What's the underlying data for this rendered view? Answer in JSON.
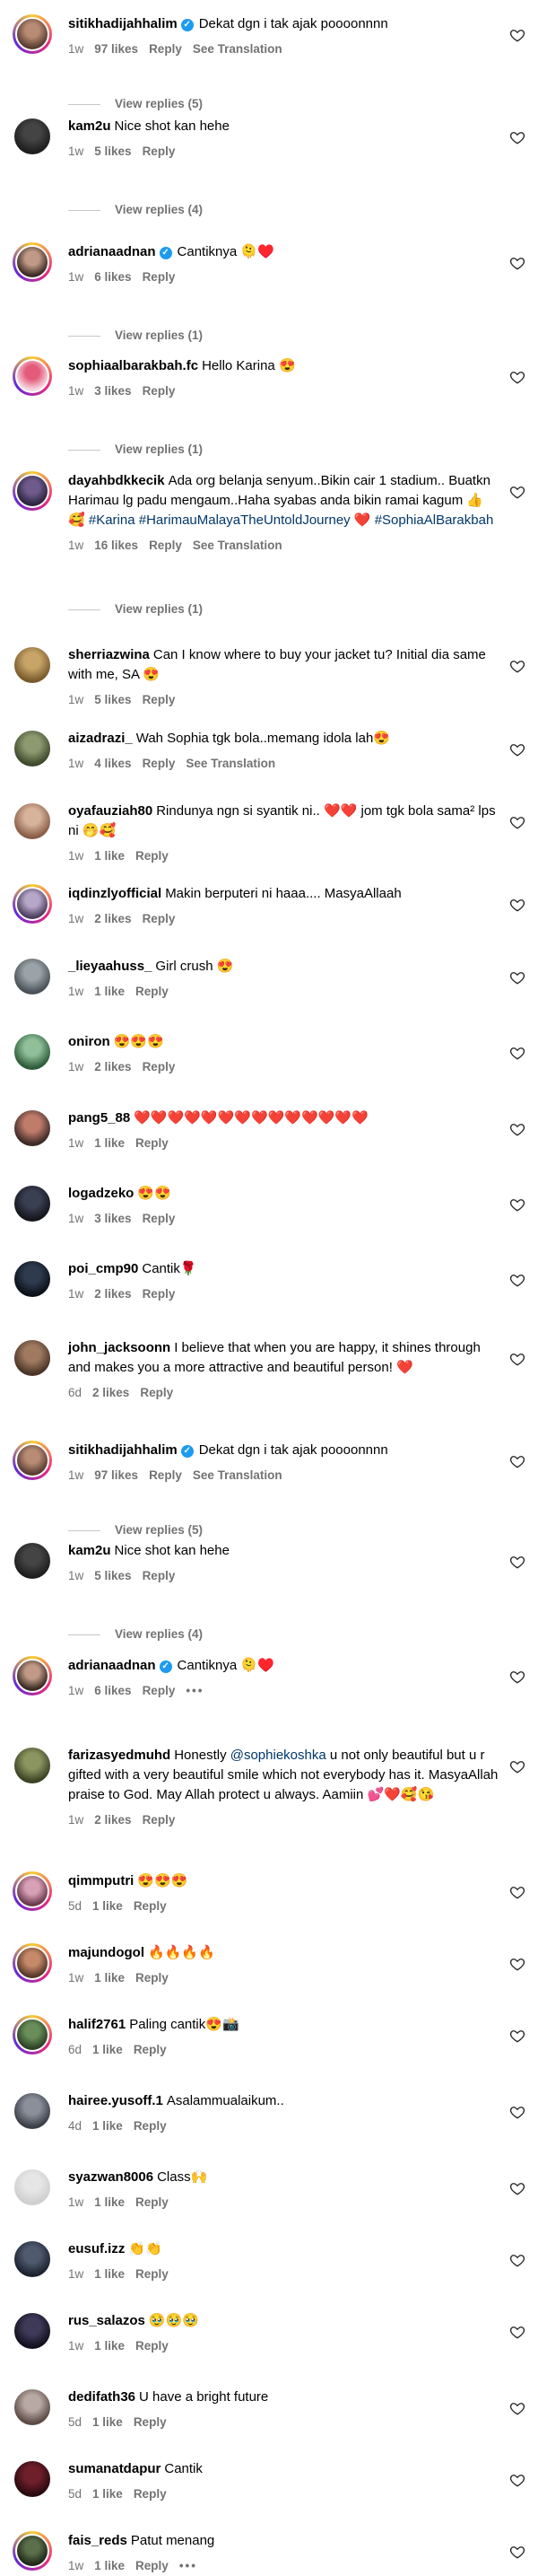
{
  "ui": {
    "reply_label": "Reply",
    "see_translation_label": "See Translation",
    "more_label": "•••",
    "verified_mark": "✓"
  },
  "comments": [
    {
      "username": "sitikhadijahhalim",
      "verified": true,
      "text": "Dekat dgn i tak ajak poooonnnn",
      "time": "1w",
      "likes": "97 likes",
      "see_translation": true,
      "view_replies": "View replies (5)",
      "avatar_colors": [
        "#b78b74",
        "#5a3d32"
      ],
      "ring": true
    },
    {
      "username": "kam2u",
      "verified": false,
      "text": "Nice shot kan hehe",
      "time": "1w",
      "likes": "5 likes",
      "see_translation": false,
      "view_replies": "View replies (4)",
      "avatar_colors": [
        "#444444",
        "#1e1e1e"
      ],
      "ring": false
    },
    {
      "username": "adrianaadnan",
      "verified": true,
      "text": "Cantiknya 🫠♥️",
      "time": "1w",
      "likes": "6 likes",
      "see_translation": false,
      "view_replies": "View replies (1)",
      "avatar_colors": [
        "#c09a86",
        "#3b2a24"
      ],
      "ring": true
    },
    {
      "username": "sophiaalbarakbah.fc",
      "verified": false,
      "text": "Hello Karina 😍",
      "time": "1w",
      "likes": "3 likes",
      "see_translation": false,
      "view_replies": "View replies (1)",
      "avatar_colors": [
        "#e35a7a",
        "#f6d7e0"
      ],
      "ring": true
    },
    {
      "username": "dayahbdkkecik",
      "verified": false,
      "text": "Ada org belanja senyum..Bikin cair 1 stadium.. Buatkn Harimau lg padu mengaum..Haha syabas anda bikin ramai kagum 👍🥰",
      "tags": "#Karina #HarimauMalayaTheUntoldJourney ❤️ #SophiaAlBarakbah",
      "time": "1w",
      "likes": "16 likes",
      "see_translation": true,
      "view_replies": "View replies (1)",
      "avatar_colors": [
        "#6f5a8c",
        "#2c2440"
      ],
      "ring": true
    },
    {
      "username": "sherriazwina",
      "verified": false,
      "text": "Can I know where to buy your jacket tu? Initial dia same with me, SA 😍",
      "time": "1w",
      "likes": "5 likes",
      "see_translation": false,
      "avatar_colors": [
        "#c7a468",
        "#7a5b2c"
      ],
      "ring": false
    },
    {
      "username": "aizadrazi_",
      "verified": false,
      "text": "Wah Sophia tgk bola..memang idola lah😍",
      "time": "1w",
      "likes": "4 likes",
      "see_translation": true,
      "avatar_colors": [
        "#8c9a70",
        "#3e4a2c"
      ],
      "ring": false
    },
    {
      "username": "oyafauziah80",
      "verified": false,
      "text": "Rindunya ngn si syantik ni.. ❤️❤️ jom tgk bola sama² lps ni 🤭🥰",
      "time": "1w",
      "likes": "1 like",
      "see_translation": false,
      "avatar_colors": [
        "#d6b39a",
        "#8a5d48"
      ],
      "ring": false
    },
    {
      "username": "iqdinzlyofficial",
      "verified": false,
      "text": "Makin berputeri ni haaa.... MasyaAllaah",
      "time": "1w",
      "likes": "2 likes",
      "see_translation": false,
      "avatar_colors": [
        "#b6a6c8",
        "#4d3f5e"
      ],
      "ring": true
    },
    {
      "username": "_lieyaahuss_",
      "verified": false,
      "text": "Girl crush 😍",
      "time": "1w",
      "likes": "1 like",
      "see_translation": false,
      "avatar_colors": [
        "#9aa3a8",
        "#4a5156"
      ],
      "ring": false
    },
    {
      "username": "oniron",
      "verified": false,
      "text": "😍😍😍",
      "time": "1w",
      "likes": "2 likes",
      "see_translation": false,
      "avatar_colors": [
        "#8fc09a",
        "#2f5c3a"
      ],
      "ring": false
    },
    {
      "username": "pang5_88",
      "verified": false,
      "text": "❤️❤️❤️❤️❤️❤️❤️❤️❤️❤️❤️❤️❤️❤️",
      "time": "1w",
      "likes": "1 like",
      "see_translation": false,
      "avatar_colors": [
        "#c07c6a",
        "#3d2a26"
      ],
      "ring": false
    },
    {
      "username": "logadzeko",
      "verified": false,
      "text": "😍😍",
      "time": "1w",
      "likes": "3 likes",
      "see_translation": false,
      "avatar_colors": [
        "#3b3f52",
        "#15161d"
      ],
      "ring": false
    },
    {
      "username": "poi_cmp90",
      "verified": false,
      "text": "Cantik🌹",
      "time": "1w",
      "likes": "2 likes",
      "see_translation": false,
      "avatar_colors": [
        "#2e3b4f",
        "#0c1119"
      ],
      "ring": false
    },
    {
      "username": "john_jacksoonn",
      "verified": false,
      "text": "I believe that when you are happy, it shines through and makes you a more attractive and beautiful person! ❤️",
      "time": "6d",
      "likes": "2 likes",
      "see_translation": false,
      "avatar_colors": [
        "#a07a60",
        "#4a3528"
      ],
      "ring": false
    },
    {
      "username": "sitikhadijahhalim",
      "verified": true,
      "text": "Dekat dgn i tak ajak poooonnnn",
      "time": "1w",
      "likes": "97 likes",
      "see_translation": true,
      "view_replies": "View replies (5)",
      "avatar_colors": [
        "#b78b74",
        "#5a3d32"
      ],
      "ring": true
    },
    {
      "username": "kam2u",
      "verified": false,
      "text": "Nice shot kan hehe",
      "time": "1w",
      "likes": "5 likes",
      "see_translation": false,
      "view_replies": "View replies (4)",
      "avatar_colors": [
        "#444444",
        "#1e1e1e"
      ],
      "ring": false
    },
    {
      "username": "adrianaadnan",
      "verified": true,
      "text": "Cantiknya 🫠♥️",
      "time": "1w",
      "likes": "6 likes",
      "see_translation": false,
      "more": true,
      "avatar_colors": [
        "#c09a86",
        "#3b2a24"
      ],
      "ring": true
    },
    {
      "username": "farizasyedmuhd",
      "verified": false,
      "text": "Honestly",
      "mention": "@sophiekoshka",
      "text2": "u not only beautiful but u r gifted with a very beautiful smile which not everybody has it. MasyaAllah praise to God. May Allah protect u always. Aamiin 💕❤️🥰😘",
      "time": "1w",
      "likes": "2 likes",
      "see_translation": false,
      "avatar_colors": [
        "#8a9560",
        "#3c4324"
      ],
      "ring": false
    },
    {
      "username": "qimmputri",
      "verified": false,
      "text": "😍😍😍",
      "time": "5d",
      "likes": "1 like",
      "see_translation": false,
      "avatar_colors": [
        "#d7a0b5",
        "#6b3a4c"
      ],
      "ring": true
    },
    {
      "username": "majundogol",
      "verified": false,
      "text": "🔥🔥🔥🔥",
      "time": "1w",
      "likes": "1 like",
      "see_translation": false,
      "avatar_colors": [
        "#c68a6a",
        "#56382a"
      ],
      "ring": true
    },
    {
      "username": "halif2761",
      "verified": false,
      "text": "Paling cantik😍📸",
      "time": "6d",
      "likes": "1 like",
      "see_translation": false,
      "avatar_colors": [
        "#6a8e5a",
        "#2d4226"
      ],
      "ring": true
    },
    {
      "username": "hairee.yusoff.1",
      "verified": false,
      "text": "Asalammualaikum..",
      "time": "4d",
      "likes": "1 like",
      "see_translation": false,
      "avatar_colors": [
        "#8a8f9a",
        "#3b3f47"
      ],
      "ring": false
    },
    {
      "username": "syazwan8006",
      "verified": false,
      "text": "Class🙌",
      "time": "1w",
      "likes": "1 like",
      "see_translation": false,
      "avatar_colors": [
        "#e6e6e6",
        "#cfcfcf"
      ],
      "ring": false
    },
    {
      "username": "eusuf.izz",
      "verified": false,
      "text": "👏👏",
      "time": "1w",
      "likes": "1 like",
      "see_translation": false,
      "avatar_colors": [
        "#4f5a6e",
        "#1c2230"
      ],
      "ring": false
    },
    {
      "username": "rus_salazos",
      "verified": false,
      "text": "🥹🥹🥹",
      "time": "1w",
      "likes": "1 like",
      "see_translation": false,
      "avatar_colors": [
        "#3f3a58",
        "#12101f"
      ],
      "ring": false
    },
    {
      "username": "dedifath36",
      "verified": false,
      "text": "U have a bright future",
      "time": "5d",
      "likes": "1 like",
      "see_translation": false,
      "avatar_colors": [
        "#b9a9a4",
        "#5b4a45"
      ],
      "ring": false
    },
    {
      "username": "sumanatdapur",
      "verified": false,
      "text": "Cantik",
      "time": "5d",
      "likes": "1 like",
      "see_translation": false,
      "avatar_colors": [
        "#6e1f2a",
        "#2a0a10"
      ],
      "ring": false
    },
    {
      "username": "fais_reds",
      "verified": false,
      "text": "Patut menang",
      "time": "1w",
      "likes": "1 like",
      "see_translation": false,
      "more": true,
      "avatar_colors": [
        "#5b6f4a",
        "#1f2a18"
      ],
      "ring": true
    }
  ]
}
